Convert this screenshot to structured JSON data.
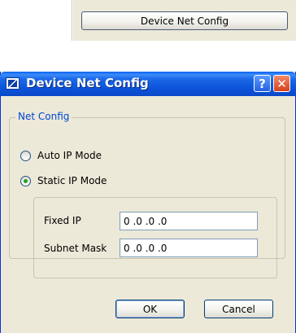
{
  "trigger": {
    "button_label": "Device Net Config"
  },
  "dialog": {
    "title": "Device Net Config",
    "help_label": "?",
    "close_label": "✕",
    "group_label": "Net Config",
    "radios": [
      {
        "label": "Auto IP Mode",
        "checked": false
      },
      {
        "label": "Static IP Mode",
        "checked": true
      }
    ],
    "fixed_ip": {
      "label": "Fixed IP",
      "value": "0 .0 .0 .0"
    },
    "subnet_mask": {
      "label": "Subnet Mask",
      "value": "0 .0 .0 .0"
    },
    "ok_label": "OK",
    "cancel_label": "Cancel"
  },
  "colors": {
    "titlebar": "#0b52d8",
    "window_bg": "#ece9d8",
    "group_label": "#0046d5",
    "radio_check": "#21a121"
  },
  "icons": {
    "app": "dialog-app-icon",
    "help": "help-icon",
    "close": "close-icon"
  }
}
